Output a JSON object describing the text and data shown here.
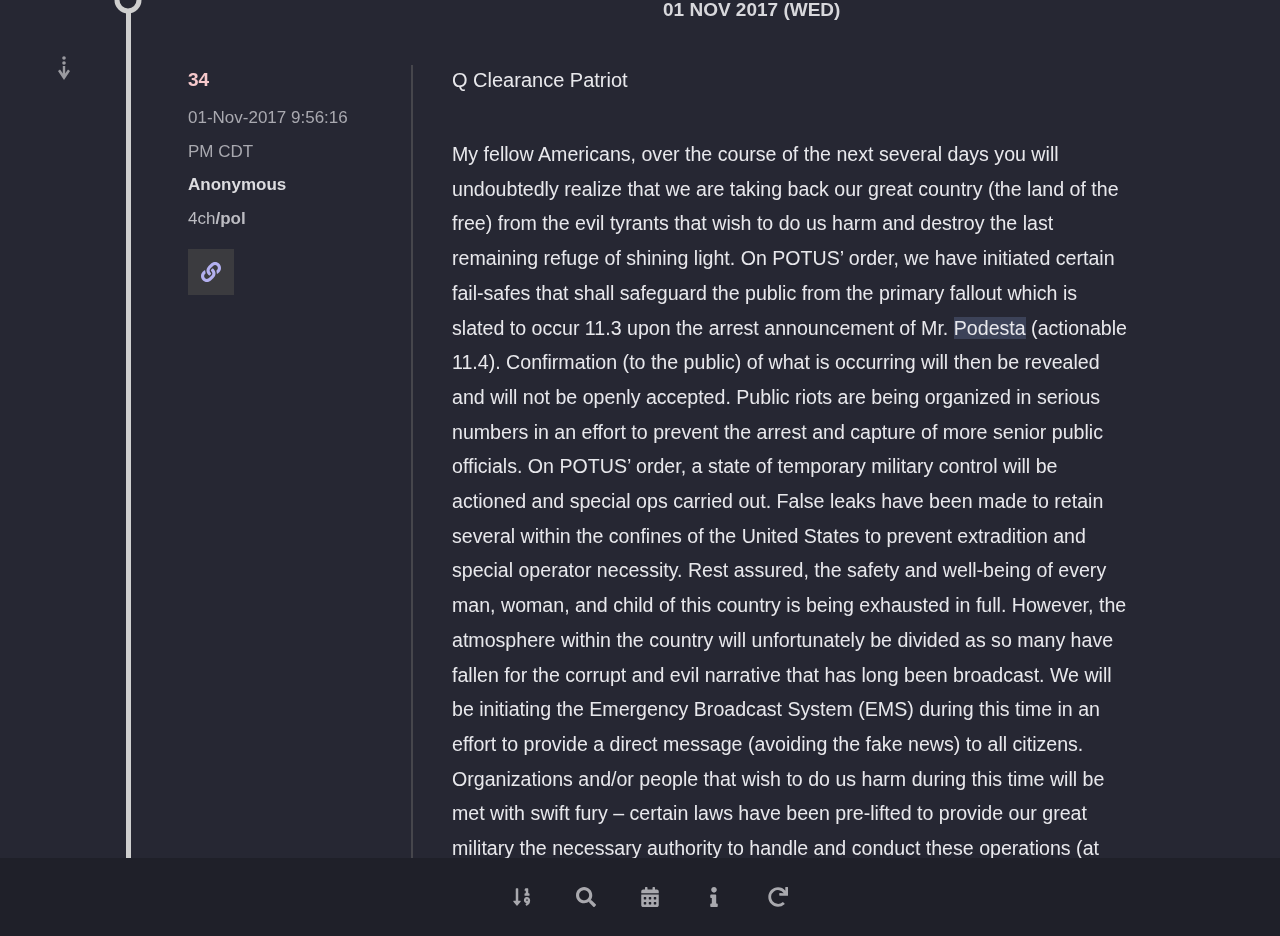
{
  "date_header": "01 NOV 2017 (WED)",
  "post": {
    "number": "34",
    "timestamp": "01-Nov-2017 9:56:16 PM CDT",
    "author": "Anonymous",
    "source": "4ch**/pol**",
    "title": "Q Clearance Patriot",
    "body_lines": [
      [
        {
          "text": "My fellow Americans, over the course of the next several days you will",
          "highlighted": false
        }
      ],
      [
        {
          "text": "undoubtedly realize that we are taking back our great country (the land of the",
          "highlighted": false
        }
      ],
      [
        {
          "text": "free) from the evil tyrants that wish to do us harm and destroy the last",
          "highlighted": false
        }
      ],
      [
        {
          "text": "remaining refuge of shining light. On POTUS’ order, we have initiated certain",
          "highlighted": false
        }
      ],
      [
        {
          "text": "fail-safes that shall safeguard the public from the primary fallout which is",
          "highlighted": false
        }
      ],
      [
        {
          "text": "slated to occur 11.3 upon the arrest announcement of Mr. ",
          "highlighted": false
        },
        {
          "text": "Podesta",
          "highlighted": true
        },
        {
          "text": " (actionable",
          "highlighted": false
        }
      ],
      [
        {
          "text": "11.4). Confirmation (to the public) of what is occurring will then be revealed",
          "highlighted": false
        }
      ],
      [
        {
          "text": "and will not be openly accepted. Public riots are being organized in serious",
          "highlighted": false
        }
      ],
      [
        {
          "text": "numbers in an effort to prevent the arrest and capture of more senior public",
          "highlighted": false
        }
      ],
      [
        {
          "text": "officials. On POTUS’ order, a state of temporary military control will be",
          "highlighted": false
        }
      ],
      [
        {
          "text": "actioned and special ops carried out. False leaks have been made to retain",
          "highlighted": false
        }
      ],
      [
        {
          "text": "several within the confines of the United States to prevent extradition and",
          "highlighted": false
        }
      ],
      [
        {
          "text": "special operator necessity. Rest assured, the safety and well-being of every",
          "highlighted": false
        }
      ],
      [
        {
          "text": "man, woman, and child of this country is being exhausted in full. However, the",
          "highlighted": false
        }
      ],
      [
        {
          "text": "atmosphere within the country will unfortunately be divided as so many have",
          "highlighted": false
        }
      ],
      [
        {
          "text": "fallen for the corrupt and evil narrative that has long been broadcast. We will",
          "highlighted": false
        }
      ],
      [
        {
          "text": "be initiating the Emergency Broadcast System (EMS) during this time in an",
          "highlighted": false
        }
      ],
      [
        {
          "text": "effort to provide a direct message (avoiding the fake news) to all citizens.",
          "highlighted": false
        }
      ],
      [
        {
          "text": "Organizations and/or people that wish to do us harm during this time will be",
          "highlighted": false
        }
      ],
      [
        {
          "text": "met with swift fury – certain laws have been pre-lifted to provide our great",
          "highlighted": false
        }
      ],
      [
        {
          "text": "military the necessary authority to handle and conduct these operations (at",
          "highlighted": false
        }
      ]
    ]
  },
  "toolbar": [
    {
      "kind": "sort"
    },
    {
      "kind": "search"
    },
    {
      "kind": "calendar"
    },
    {
      "kind": "info"
    },
    {
      "kind": "refresh"
    }
  ]
}
